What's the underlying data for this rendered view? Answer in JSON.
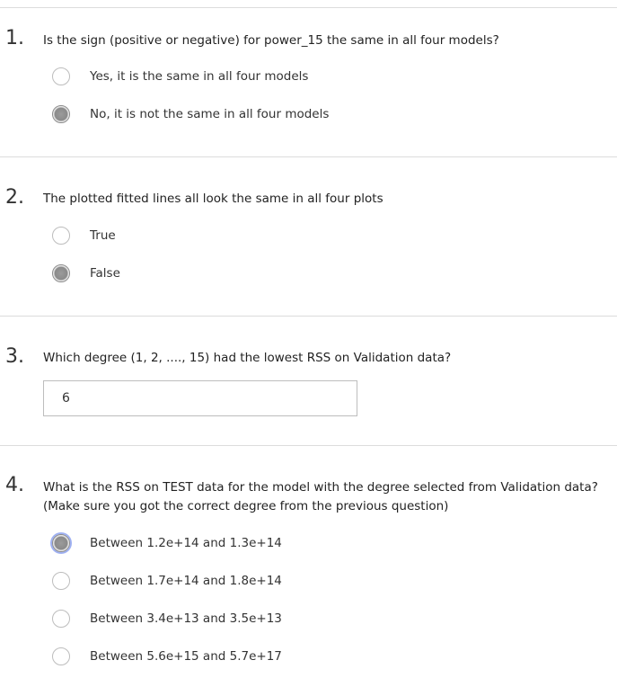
{
  "questions": [
    {
      "number": "1.",
      "text": "Is the sign (positive or negative) for power_15 the same in all four models?",
      "options": [
        {
          "label": "Yes, it is the same in all four models",
          "selected": false
        },
        {
          "label": "No, it is not the same in all four models",
          "selected": true
        }
      ]
    },
    {
      "number": "2.",
      "text": "The plotted fitted lines all look the same in all four plots",
      "options": [
        {
          "label": "True",
          "selected": false
        },
        {
          "label": "False",
          "selected": true
        }
      ]
    },
    {
      "number": "3.",
      "text": "Which degree (1, 2, ...., 15) had the lowest RSS on Validation data?",
      "answer": "6"
    },
    {
      "number": "4.",
      "text": "What is the RSS on TEST data for the model with the degree selected from Validation data? (Make sure you got the correct degree from the previous question)",
      "options": [
        {
          "label": "Between 1.2e+14 and 1.3e+14",
          "selected": true
        },
        {
          "label": "Between 1.7e+14 and 1.8e+14",
          "selected": false
        },
        {
          "label": "Between 3.4e+13 and 3.5e+13",
          "selected": false
        },
        {
          "label": "Between 5.6e+15 and 5.7e+17",
          "selected": false
        }
      ]
    }
  ],
  "colors": {
    "divider": "#dcdcdc",
    "focus_ring": "#9fb1f2",
    "selected_radio": "#8a8a8a"
  }
}
